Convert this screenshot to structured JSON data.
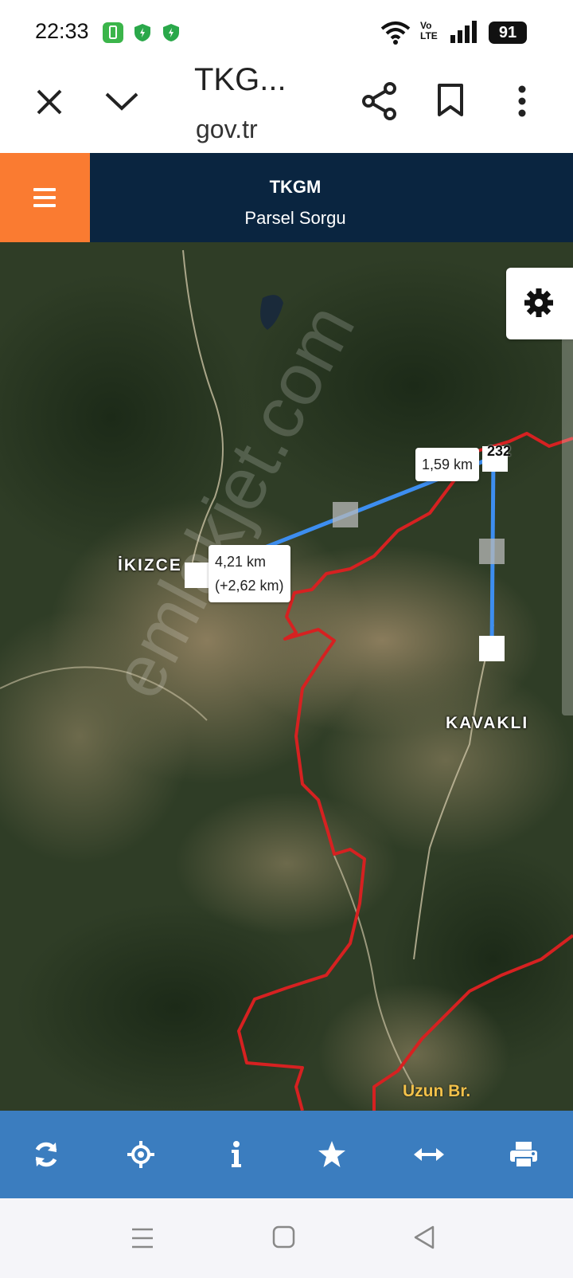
{
  "status_bar": {
    "time": "22:33",
    "network": "Vo LTE",
    "battery": "91"
  },
  "browser": {
    "title": "TKG...",
    "domain": "gov.tr",
    "icons": [
      "close-icon",
      "chevron-down-icon",
      "share-icon",
      "bookmark-icon",
      "more-vert-icon"
    ]
  },
  "app_header": {
    "title": "TKGM",
    "subtitle": "Parsel Sorgu"
  },
  "map": {
    "measure_labels": {
      "segment_1": "1,59 km",
      "total_line1": "4,21 km",
      "total_line2": "(+2,62 km)"
    },
    "tile_fragment": "232",
    "places": {
      "ikizce": "İKIZCE",
      "kavakli": "KAVAKLI",
      "uzun": "Uzun Br."
    },
    "watermark": "emlakjet.com",
    "line_color": "#3d8ef0",
    "boundary_color": "#d62121"
  },
  "toolbar": {
    "buttons": [
      "refresh-icon",
      "locate-icon",
      "info-icon",
      "favorite-star-icon",
      "measure-icon",
      "print-icon"
    ]
  },
  "colors": {
    "header_bg": "#0a2540",
    "menu_accent": "#fa7b31",
    "toolbar_bg": "#3b7dbf"
  }
}
